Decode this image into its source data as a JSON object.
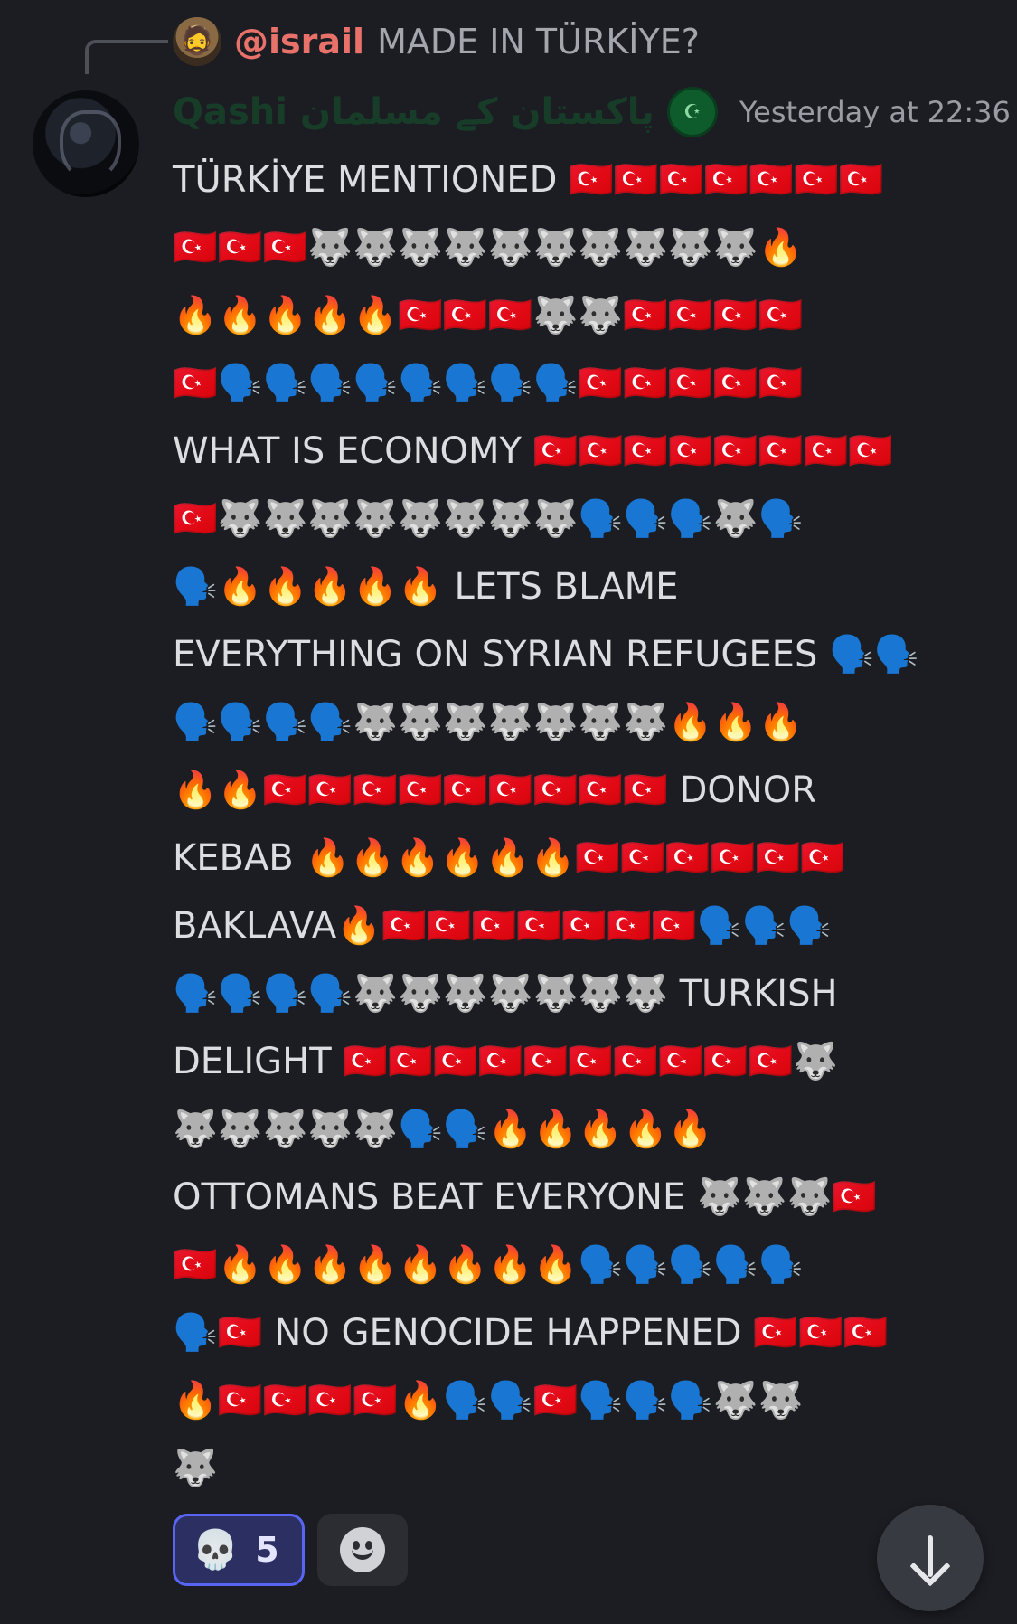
{
  "reply": {
    "author": "@israil",
    "text": "MADE IN TÜRKİYE?",
    "avatar_icon": "🧔"
  },
  "message": {
    "author": "Qashi",
    "author_suffix": "پاکستان کے مسلمان",
    "badge_icon": "☪",
    "timestamp": "Yesterday at 22:36",
    "lines": [
      "TÜRKİYE MENTIONED 🇹🇷🇹🇷🇹🇷🇹🇷🇹🇷🇹🇷🇹🇷",
      "🇹🇷🇹🇷🇹🇷🐺🐺🐺🐺🐺🐺🐺🐺🐺🐺🔥",
      "🔥🔥🔥🔥🔥🇹🇷🇹🇷🇹🇷🐺🐺🇹🇷🇹🇷🇹🇷🇹🇷",
      "🇹🇷🗣️🗣️🗣️🗣️🗣️🗣️🗣️🗣️🇹🇷🇹🇷🇹🇷🇹🇷🇹🇷",
      "WHAT IS ECONOMY 🇹🇷🇹🇷🇹🇷🇹🇷🇹🇷🇹🇷🇹🇷🇹🇷",
      "🇹🇷🐺🐺🐺🐺🐺🐺🐺🐺🗣️🗣️🗣️🐺🗣️",
      "🗣️🔥🔥🔥🔥🔥 LETS BLAME",
      "EVERYTHING ON SYRIAN REFUGEES 🗣️🗣️",
      "🗣️🗣️🗣️🗣️🐺🐺🐺🐺🐺🐺🐺🔥🔥🔥",
      "🔥🔥🇹🇷🇹🇷🇹🇷🇹🇷🇹🇷🇹🇷🇹🇷🇹🇷🇹🇷 DONOR",
      "KEBAB 🔥🔥🔥🔥🔥🔥🇹🇷🇹🇷🇹🇷🇹🇷🇹🇷🇹🇷",
      "BAKLAVA🔥🇹🇷🇹🇷🇹🇷🇹🇷🇹🇷🇹🇷🇹🇷🗣️🗣️🗣️",
      "🗣️🗣️🗣️🗣️🐺🐺🐺🐺🐺🐺🐺 TURKISH",
      "DELIGHT 🇹🇷🇹🇷🇹🇷🇹🇷🇹🇷🇹🇷🇹🇷🇹🇷🇹🇷🇹🇷🐺",
      "🐺🐺🐺🐺🐺🗣️🗣️🔥🔥🔥🔥🔥",
      "OTTOMANS BEAT EVERYONE 🐺🐺🐺🇹🇷",
      "🇹🇷🔥🔥🔥🔥🔥🔥🔥🔥🗣️🗣️🗣️🗣️🗣️",
      "🗣️🇹🇷 NO GENOCIDE HAPPENED 🇹🇷🇹🇷🇹🇷",
      "🔥🇹🇷🇹🇷🇹🇷🇹🇷🔥🗣️🗣️🇹🇷🗣️🗣️🗣️🐺🐺",
      "🐺"
    ]
  },
  "reactions": [
    {
      "emoji": "💀",
      "count": "5",
      "active": true
    }
  ],
  "add_reaction_icon": "smiley-add-reaction-icon",
  "scroll_button_icon": "arrow-down-icon",
  "colors": {
    "background": "#1c1d22",
    "reply_author": "#e8716a",
    "username": "#173d29",
    "reaction_active_border": "#5865f2",
    "reaction_active_bg": "#2c2f62"
  }
}
